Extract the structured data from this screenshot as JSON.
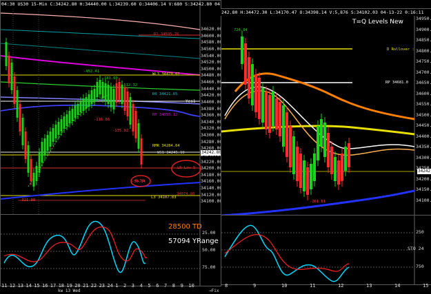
{
  "left": {
    "header": "04:30  US30  15-Min  C:34242.80  H:34440.00  L:34239.60  O:34406.14  V:680  S:34242.80  04-13-22  1:11",
    "price_axis": [
      "34620.00",
      "34600.00",
      "34580.00",
      "34560.00",
      "34540.00",
      "34520.00",
      "34500.00",
      "34480.00",
      "34460.00",
      "34440.00",
      "34420.00",
      "34400.00",
      "34380.00",
      "34360.00",
      "34340.00",
      "34320.00",
      "34300.00",
      "34280.00",
      "34260.00",
      "34240.00",
      "34220.00",
      "34200.00",
      "34180.00",
      "34160.00",
      "34140.00",
      "34120.00",
      "34100.00"
    ],
    "current_price_badge": "34242.80",
    "levels": {
      "r1": "R1  34595.76",
      "wl3": "WL3  34470.07",
      "r0": "R0  34421.65",
      "rp": "RP  34355.12",
      "rmr": "RMR  34284.64",
      "ws1": "WS1  34245.10",
      "l3": "L3  34107.83",
      "l3b": "34074.80"
    },
    "annotations": {
      "yes1": "Yes1",
      "a1": "-452.41",
      "a2": "181.60",
      "a3": "-112.32",
      "a4": "-116.66",
      "a5": "-135.92",
      "a6": "-321.98",
      "a7": "-50.34",
      "circle_main": "LN Low  5",
      "circle_small": "0.53"
    },
    "osc_axis": [
      "25.00",
      "50.00",
      "75.00"
    ],
    "osc_texts": {
      "td": "28500 TD",
      "yrange": "57094 YRange"
    },
    "x_axis": [
      "11",
      "12",
      "13",
      "14",
      "15",
      "16",
      "17",
      "18",
      "19",
      "20",
      "21",
      "22",
      "23",
      "24",
      "1",
      "2",
      "3",
      "4",
      "5",
      "6",
      "7",
      "8",
      "9",
      "10"
    ],
    "x_day": "kw 13 Wed",
    "corner": "→Fix"
  },
  "right": {
    "header": "242.80  H:34472.30  L:34170.47  O:34398.14  V:5,876  S:34102.03  04-13-22  0:16:11",
    "title": "T=Q Levels New",
    "price_axis": [
      "34950.0",
      "34900.0",
      "34850.0",
      "34800.0",
      "34750.0",
      "34700.0",
      "34650.0",
      "34600.0",
      "34550.0",
      "34500.0",
      "34450.0",
      "34400.0",
      "34350.0",
      "34300.0",
      "34250.0",
      "34200.0",
      "34150.0",
      "34100.0"
    ],
    "current_price_badge": "34242.8",
    "levels": {
      "rollover": "D  Rollover :",
      "rp": "RP  34681.0",
      "top_label": "724.84",
      "low_label": "-261.81"
    },
    "osc_axis": [
      "250",
      "STO 24",
      "750"
    ],
    "x_axis": [
      "8",
      "9",
      "10",
      "11",
      "12",
      "13",
      "14",
      "15"
    ]
  },
  "colors": {
    "up": "#19d419",
    "down": "#ff2a2a",
    "yellow": "#e8e000",
    "magenta": "#e000e0",
    "cyan": "#00c8c8",
    "blue": "#2233ff",
    "orange": "#ff8000"
  }
}
